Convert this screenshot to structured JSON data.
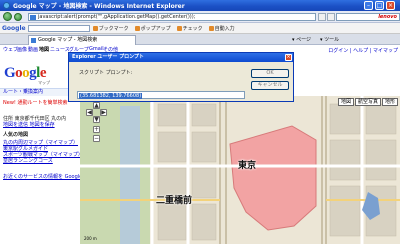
{
  "window": {
    "title": "Google マップ - 地図検索 - Windows Internet Explorer"
  },
  "address_bar": {
    "url": "javascript:alert(prompt(\"\",gApplication.getMap().getCenter()));"
  },
  "search_box": {
    "brand": "lenovo"
  },
  "google_toolbar": {
    "logo": "Google",
    "items": [
      "ブックマーク",
      "ポップアップ",
      "チェック",
      "自動入力"
    ],
    "right_items": [
      "ページ",
      "ツール"
    ]
  },
  "tab": {
    "label": "Google マップ - 地図検索"
  },
  "page": {
    "nav_links": [
      "ウェブ",
      "画像",
      "動画",
      "地図",
      "ニュース",
      "グループ",
      "Gmail",
      "その他"
    ],
    "right_links": [
      "ログイン",
      "ヘルプ",
      "マイマップ"
    ],
    "logo": "Google",
    "logo_sub": "マップ",
    "results_bar": "ルート・乗換案内",
    "new_text": "New! 通勤ルートを簡単検索",
    "address_line1": "住所 東京都千代田区 丸の内",
    "address_line2": "地図を送信 地図を保存",
    "recent_heading": "人気の地図",
    "recent_links": [
      "丸の内周辺マップ（マイマップ）",
      "東京駅グルメガイド",
      "スポーツ観戦マップ（マイマップ）",
      "皇居ランニングコース"
    ],
    "bottom_link": "お近くのサービスの情報を Google マップに掲載"
  },
  "dialog": {
    "title": "Explorer ユーザー プロンプト",
    "close_glyph": "×",
    "prompt": "スクリプト プロンプト:",
    "ok": "OK",
    "cancel": "キャンセル",
    "value": "(35.681382, 139.76608)"
  },
  "map": {
    "labels": [
      "東京",
      "二重橋前"
    ],
    "map_types": [
      "地図",
      "航空写真",
      "地形"
    ],
    "scale": "200 m"
  },
  "icons": [
    "ie-icon",
    "back-icon",
    "forward-icon",
    "close-icon",
    "minimize-icon",
    "maximize-icon"
  ]
}
